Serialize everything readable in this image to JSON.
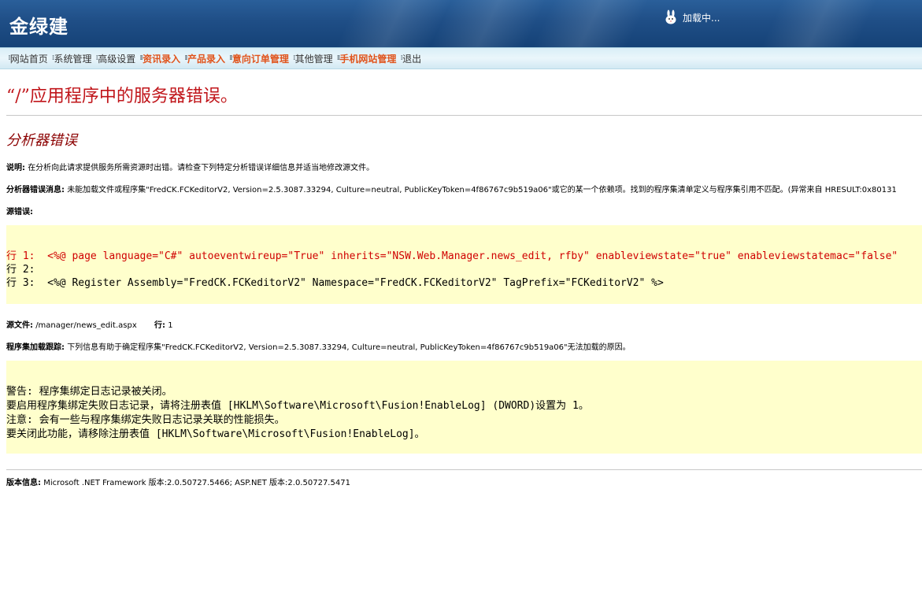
{
  "header": {
    "brand": "金绿建",
    "loading": "加载中..."
  },
  "nav": [
    {
      "label": "网站首页",
      "highlight": false
    },
    {
      "label": "系统管理",
      "highlight": false
    },
    {
      "label": "高级设置",
      "highlight": false
    },
    {
      "label": "资讯录入",
      "highlight": true
    },
    {
      "label": "产品录入",
      "highlight": true
    },
    {
      "label": "意向订单管理",
      "highlight": true
    },
    {
      "label": "其他管理",
      "highlight": false
    },
    {
      "label": "手机网站管理",
      "highlight": true
    },
    {
      "label": "退出",
      "highlight": false
    }
  ],
  "error": {
    "title": "“/”应用程序中的服务器错误。",
    "subtitle": "分析器错误",
    "desc_label": "说明:",
    "desc_text": "在分析向此请求提供服务所需资源时出错。请检查下列特定分析错误详细信息并适当地修改源文件。",
    "msg_label": "分析器错误消息:",
    "msg_text": "未能加载文件或程序集\"FredCK.FCKeditorV2, Version=2.5.3087.33294, Culture=neutral, PublicKeyToken=4f86767c9b519a06\"或它的某一个依赖项。找到的程序集清单定义与程序集引用不匹配。(异常来自 HRESULT:0x80131",
    "src_error_label": "源错误:",
    "code_lines": [
      {
        "prefix": "行 1:  ",
        "code": "<%@ page language=\"C#\" autoeventwireup=\"True\" inherits=\"NSW.Web.Manager.news_edit, rfby\" enableviewstate=\"true\" enableviewstatemac=\"false\"",
        "red": true
      },
      {
        "prefix": "行 2:",
        "code": "",
        "red": false
      },
      {
        "prefix": "行 3:  ",
        "code": "<%@ Register Assembly=\"FredCK.FCKeditorV2\" Namespace=\"FredCK.FCKeditorV2\" TagPrefix=\"FCKeditorV2\" %>",
        "red": false
      }
    ],
    "src_file_label": "源文件:",
    "src_file": "/manager/news_edit.aspx",
    "line_label": "行:",
    "line_no": "1",
    "trace_label": "程序集加载跟踪:",
    "trace_text": "下列信息有助于确定程序集\"FredCK.FCKeditorV2, Version=2.5.3087.33294, Culture=neutral, PublicKeyToken=4f86767c9b519a06\"无法加载的原因。",
    "warning_lines": [
      "警告: 程序集绑定日志记录被关闭。",
      "要启用程序集绑定失败日志记录，请将注册表值 [HKLM\\Software\\Microsoft\\Fusion!EnableLog] (DWORD)设置为 1。",
      "注意: 会有一些与程序集绑定失败日志记录关联的性能损失。",
      "要关闭此功能，请移除注册表值 [HKLM\\Software\\Microsoft\\Fusion!EnableLog]。"
    ],
    "version_label": "版本信息:",
    "version_text": "Microsoft .NET Framework 版本:2.0.50727.5466; ASP.NET 版本:2.0.50727.5471"
  },
  "colors": {
    "header": "#1f4e86",
    "title_red": "#c0151a",
    "nav_highlight": "#e0531b",
    "code_bg": "#ffffcc"
  }
}
